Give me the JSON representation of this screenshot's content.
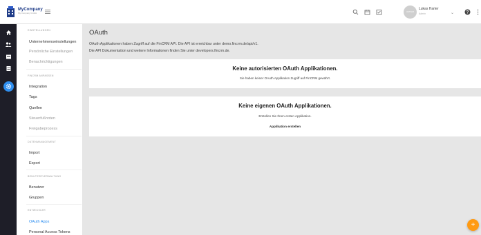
{
  "topbar": {
    "logo_text": "MyCompany",
    "logo_sub": "My Company GmbH",
    "user": {
      "name": "Lukas Harter",
      "role": "Admin",
      "avatar_text": "AVATAR"
    }
  },
  "sidebar": {
    "sections": [
      {
        "title": "EINSTELLUNGEN",
        "items": [
          {
            "label": "Unternehmenseinstellungen",
            "state": "normal"
          },
          {
            "label": "Persönliche Einstellungen",
            "state": "muted"
          },
          {
            "label": "Benachrichtigungen",
            "state": "muted"
          }
        ]
      },
      {
        "title": "FINCRM ANPASSEN",
        "items": [
          {
            "label": "Integration",
            "state": "normal"
          },
          {
            "label": "Tags",
            "state": "normal"
          },
          {
            "label": "Quellen",
            "state": "normal"
          },
          {
            "label": "Steuerfußnoten",
            "state": "muted"
          },
          {
            "label": "Freigabeprozess",
            "state": "muted"
          }
        ]
      },
      {
        "title": "DATENMANAGEMENT",
        "items": [
          {
            "label": "Import",
            "state": "normal"
          },
          {
            "label": "Export",
            "state": "normal"
          }
        ]
      },
      {
        "title": "BENUTZERVERWALTUNG",
        "items": [
          {
            "label": "Benutzer",
            "state": "normal"
          },
          {
            "label": "Gruppen",
            "state": "normal"
          }
        ]
      },
      {
        "title": "ENTWICKLER",
        "items": [
          {
            "label": "OAuth Apps",
            "state": "active"
          },
          {
            "label": "Personal Access Tokens",
            "state": "normal"
          }
        ]
      }
    ]
  },
  "main": {
    "title": "OAuth",
    "intro_line1": "OAuth Applikationen haben Zugriff auf die FinCRM API. Die API ist erreichbar unter demo.fincrm.de/api/v1.",
    "intro_line2": "Die API Dokumentation und weitere Informationen finden Sie unter developers.fincrm.de.",
    "authorized_card": {
      "title": "Keine autorisierten OAuth Applikationen.",
      "text": "Sie haben keiner OAuth Applikation Zugriff auf FinCRM gewährt."
    },
    "own_card": {
      "title": "Keine eigenen OAuth Applikationen.",
      "text": "Erstellen Sie Ihren ersten Applikation.",
      "link": "Applikation erstellen"
    }
  },
  "fab_label": "+",
  "colors": {
    "accent": "#2f8ff0",
    "fab": "#ff9a12",
    "rail": "#1e1e28",
    "background": "#e6e6e6"
  }
}
